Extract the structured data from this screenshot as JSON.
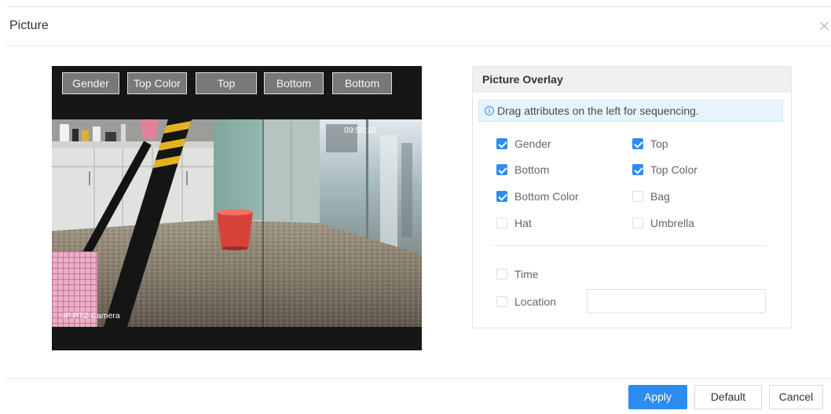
{
  "dialog": {
    "title": "Picture",
    "close_icon": "close-icon"
  },
  "preview": {
    "tags": [
      "Gender",
      "Top Color",
      "Top",
      "Bottom",
      "Bottom"
    ],
    "camera": {
      "name_osd": "IP PTZ Camera",
      "time_osd": "09:50:10"
    }
  },
  "overlay": {
    "title": "Picture Overlay",
    "info_icon": "info-icon",
    "info_text": "Drag attributes on the left for sequencing.",
    "attributes": [
      {
        "label": "Gender",
        "checked": true
      },
      {
        "label": "Top",
        "checked": true
      },
      {
        "label": "Bottom",
        "checked": true
      },
      {
        "label": "Top Color",
        "checked": true
      },
      {
        "label": "Bottom Color",
        "checked": true
      },
      {
        "label": "Bag",
        "checked": false
      },
      {
        "label": "Hat",
        "checked": false
      },
      {
        "label": "Umbrella",
        "checked": false
      }
    ],
    "time": {
      "label": "Time",
      "checked": false
    },
    "location": {
      "label": "Location",
      "checked": false,
      "value": ""
    }
  },
  "footer": {
    "apply_label": "Apply",
    "default_label": "Default",
    "cancel_label": "Cancel"
  },
  "colors": {
    "accent": "#2d8cf0",
    "preview_background": "#161616"
  }
}
